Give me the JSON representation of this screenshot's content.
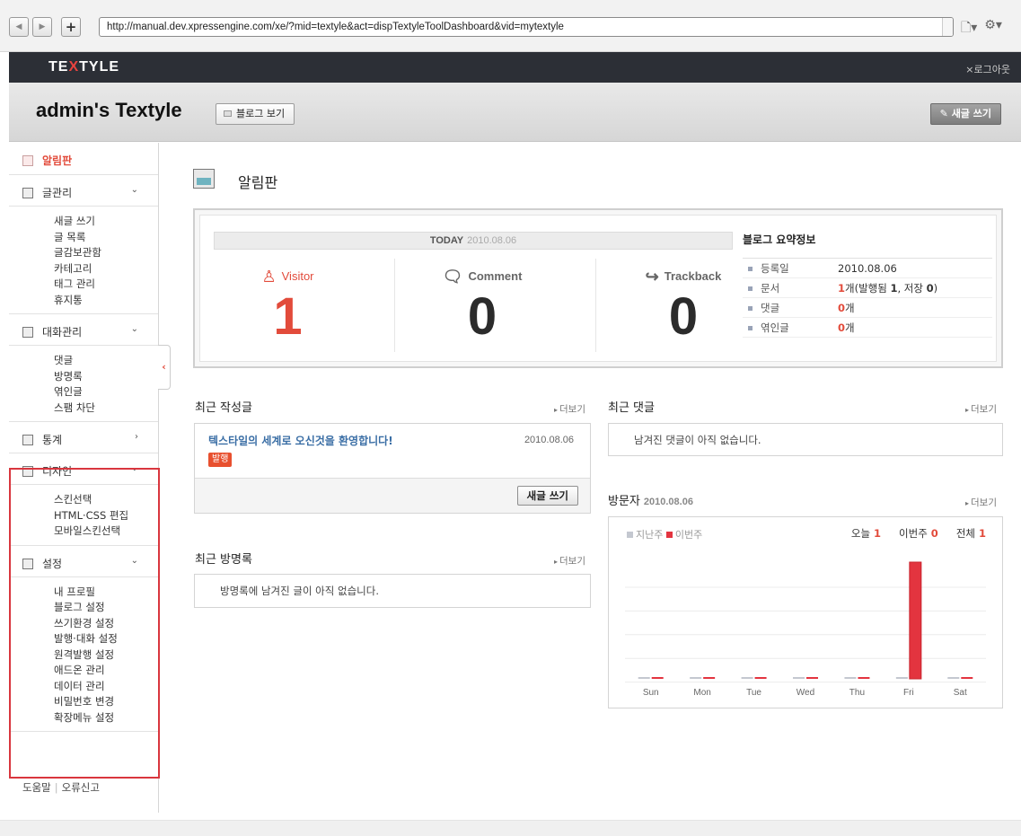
{
  "browser": {
    "url": "http://manual.dev.xpressengine.com/xe/?mid=textyle&act=dispTextyleToolDashboard&vid=mytextyle",
    "back_icon": "back-arrow-icon",
    "forward_icon": "forward-arrow-icon",
    "plus_label": "+",
    "page_icon": "page-icon",
    "gear_icon": "gear-icon"
  },
  "header": {
    "logo_pre": "TE",
    "logo_x": "X",
    "logo_post": "TYLE",
    "logout": "×로그아웃",
    "blog_title": "admin's Textyle",
    "view_blog": "블로그 보기",
    "write_new": "새글 쓰기"
  },
  "sidebar": {
    "dashboard": "알림판",
    "sections": [
      {
        "label": "글관리",
        "arrow": "⌄",
        "items": [
          "새글 쓰기",
          "글 목록",
          "글감보관함",
          "카테고리",
          "태그 관리",
          "휴지통"
        ]
      },
      {
        "label": "대화관리",
        "arrow": "⌄",
        "items": [
          "댓글",
          "방명록",
          "엮인글",
          "스팸 차단"
        ]
      },
      {
        "label": "통계",
        "arrow": "›",
        "items": []
      },
      {
        "label": "디자인",
        "arrow": "⌄",
        "items": [
          "스킨선택",
          "HTML·CSS 편집",
          "모바일스킨선택"
        ]
      },
      {
        "label": "설정",
        "arrow": "⌄",
        "items": [
          "내 프로필",
          "블로그 설정",
          "쓰기환경 설정",
          "발행·대화 설정",
          "원격발행 설정",
          "애드온 관리",
          "데이터 관리",
          "비밀번호 변경",
          "확장메뉴 설정"
        ]
      }
    ],
    "footer_help": "도움말",
    "footer_report": "오류신고",
    "collapse": "‹"
  },
  "main": {
    "page_title": "알림판",
    "today_label": "TODAY",
    "today_date": "2010.08.06",
    "stats": [
      {
        "label": "Visitor",
        "value": "1",
        "icon": "visitor-icon"
      },
      {
        "label": "Comment",
        "value": "0",
        "icon": "comment-icon"
      },
      {
        "label": "Trackback",
        "value": "0",
        "icon": "trackback-icon"
      }
    ],
    "summary": {
      "title": "블로그 요약정보",
      "rows": [
        {
          "key": "등록일",
          "value": "2010.08.06"
        },
        {
          "key": "문서",
          "value_num": "1",
          "value_rest": "개(발행됨 ",
          "value_pub": "1",
          "value_mid": ", 저장 ",
          "value_saved": "0",
          "value_end": ")"
        },
        {
          "key": "댓글",
          "value_num": "0",
          "value_unit": "개"
        },
        {
          "key": "엮인글",
          "value_num": "0",
          "value_unit": "개"
        }
      ]
    },
    "recent_posts": {
      "title": "최근 작성글",
      "more": "더보기",
      "post_title": "텍스타일의 세계로 오신것을 환영합니다!",
      "post_date": "2010.08.06",
      "badge": "발행",
      "write_button": "새글 쓰기"
    },
    "recent_comments": {
      "title": "최근 댓글",
      "more": "더보기",
      "empty": "남겨진 댓글이 아직 없습니다."
    },
    "recent_guestbook": {
      "title": "최근 방명록",
      "more": "더보기",
      "empty": "방명록에 남겨진 글이 아직 없습니다."
    },
    "visitors": {
      "title": "방문자",
      "date": "2010.08.06",
      "more": "더보기",
      "legend_last": "지난주",
      "legend_this": "이번주",
      "today_label": "오늘",
      "today_value": "1",
      "week_label": "이번주",
      "week_value": "0",
      "total_label": "전체",
      "total_value": "1"
    }
  },
  "chart_data": {
    "type": "bar",
    "categories": [
      "Sun",
      "Mon",
      "Tue",
      "Wed",
      "Thu",
      "Fri",
      "Sat"
    ],
    "series": [
      {
        "name": "지난주",
        "values": [
          0,
          0,
          0,
          0,
          0,
          0,
          0
        ],
        "color": "#c4c8d0"
      },
      {
        "name": "이번주",
        "values": [
          0,
          0,
          0,
          0,
          0,
          1,
          0
        ],
        "color": "#e3343f"
      }
    ],
    "ylim": [
      0,
      1
    ]
  }
}
